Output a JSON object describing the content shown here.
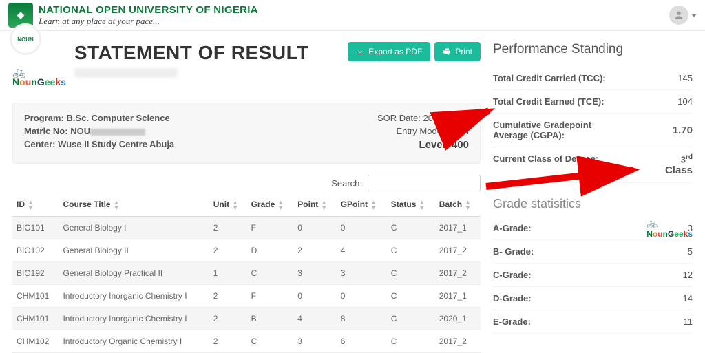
{
  "header": {
    "uni_name": "NATIONAL OPEN UNIVERSITY OF NIGERIA",
    "tagline": "Learn at any place at your pace...",
    "badge": "NOUN"
  },
  "title": "STATEMENT OF RESULT",
  "buttons": {
    "export": "Export as PDF",
    "print": "Print"
  },
  "student": {
    "program_label": "Program:",
    "program": "B.Sc. Computer Science",
    "matric_label": "Matric No:",
    "matric": "NOU",
    "center_label": "Center:",
    "center": "Wuse II Study Centre Abuja",
    "sor_date_label": "SOR Date:",
    "sor_date": "2022-06-30",
    "entry_label": "Entry Mode:",
    "entry": "Open",
    "level_label": "Level:",
    "level": "400"
  },
  "search_label": "Search:",
  "columns": {
    "id": "ID",
    "title": "Course Title",
    "unit": "Unit",
    "grade": "Grade",
    "point": "Point",
    "gpoint": "GPoint",
    "status": "Status",
    "batch": "Batch"
  },
  "rows": [
    {
      "id": "BIO101",
      "title": "General Biology I",
      "unit": "2",
      "grade": "F",
      "point": "0",
      "gpoint": "0",
      "status": "C",
      "batch": "2017_1"
    },
    {
      "id": "BIO102",
      "title": "General Biology II",
      "unit": "2",
      "grade": "D",
      "point": "2",
      "gpoint": "4",
      "status": "C",
      "batch": "2017_2"
    },
    {
      "id": "BIO192",
      "title": "General Biology Practical II",
      "unit": "1",
      "grade": "C",
      "point": "3",
      "gpoint": "3",
      "status": "C",
      "batch": "2017_2"
    },
    {
      "id": "CHM101",
      "title": "Introductory Inorganic Chemistry I",
      "unit": "2",
      "grade": "F",
      "point": "0",
      "gpoint": "0",
      "status": "C",
      "batch": "2017_1"
    },
    {
      "id": "CHM101",
      "title": "Introductory Inorganic Chemistry I",
      "unit": "2",
      "grade": "B",
      "point": "4",
      "gpoint": "8",
      "status": "C",
      "batch": "2020_1"
    },
    {
      "id": "CHM102",
      "title": "Introductory Organic Chemistry I",
      "unit": "2",
      "grade": "C",
      "point": "3",
      "gpoint": "6",
      "status": "C",
      "batch": "2017_2"
    }
  ],
  "standing": {
    "title": "Performance Standing",
    "tcc_label": "Total Credit Carried (TCC):",
    "tcc": "145",
    "tce_label": "Total Credit Earned (TCE):",
    "tce": "104",
    "cgpa_label": "Cumulative Gradepoint Average (CGPA):",
    "cgpa": "1.70",
    "class_label": "Current Class of Degree:",
    "class_ord": "3",
    "class_sup": "rd",
    "class_name": "Class"
  },
  "grades": {
    "title": "Grade statisitics",
    "a_label": "A-Grade:",
    "a": "3",
    "b_label": "B- Grade:",
    "b": "5",
    "c_label": "C-Grade:",
    "c": "12",
    "d_label": "D-Grade:",
    "d": "14",
    "e_label": "E-Grade:",
    "e": "11"
  },
  "watermark": {
    "n": "N",
    "o": "o",
    "u": "u",
    "nn": "n",
    "g": "G",
    "e": "e",
    "ee": "e",
    "k": "k",
    "s": "s"
  }
}
